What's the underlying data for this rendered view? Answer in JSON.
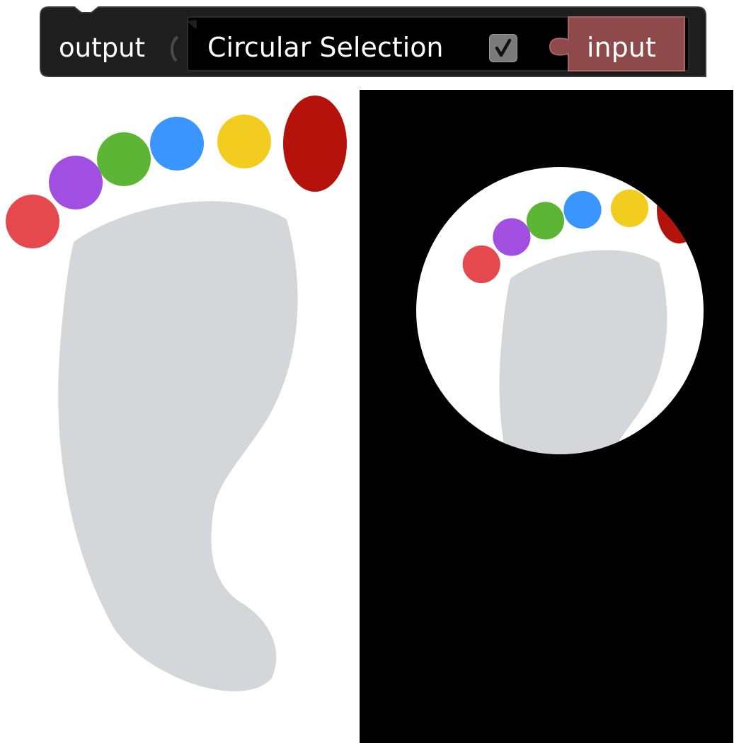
{
  "block": {
    "output_label": "output",
    "field_label": "Circular Selection",
    "checkbox_checked": true,
    "input_label": "input",
    "colors": {
      "block_bg": "#1e1e1e",
      "input_socket": "#8e4a4b",
      "checkbox_bg": "#7a7a7a"
    }
  },
  "image": {
    "foot_color": "#d5d6da",
    "toe_colors": {
      "red": "#e5484d",
      "purple": "#a04fe0",
      "green": "#5db536",
      "blue": "#3b95ff",
      "yellow": "#f2cd1f",
      "dark_red": "#b4120a"
    },
    "selection_shape": "circle"
  }
}
